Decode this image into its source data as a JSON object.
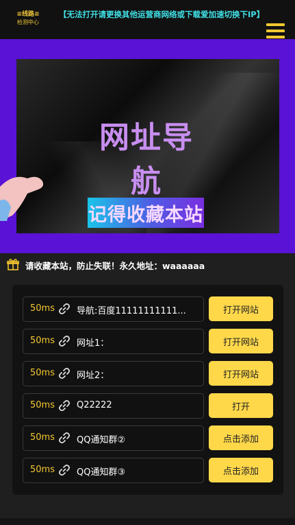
{
  "header": {
    "logo_line1": "≡线路≡",
    "logo_line2": "检测中心",
    "notice": "【无法打开请更换其他运营商网络或下载爱加速切换下IP】",
    "menu_icon": "hamburger-menu-icon"
  },
  "banner": {
    "title": "网址导航",
    "subtitle": "记得收藏本站"
  },
  "bookmark": {
    "icon": "gift-icon",
    "text": "请收藏本站，防止失联！永久地址：waaaaaa"
  },
  "rows": [
    {
      "latency": "50ms",
      "label": "导航:百度11111111111...",
      "button": "打开网站"
    },
    {
      "latency": "50ms",
      "label": "网址1：",
      "button": "打开网站"
    },
    {
      "latency": "50ms",
      "label": "网址2：",
      "button": "打开网站"
    },
    {
      "latency": "50ms",
      "label": "Q22222",
      "button": "打开"
    },
    {
      "latency": "50ms",
      "label": "QQ通知群②",
      "button": "点击添加"
    },
    {
      "latency": "50ms",
      "label": "QQ通知群③",
      "button": "点击添加"
    }
  ],
  "colors": {
    "accent": "#ffd84a",
    "notice": "#40e0e6",
    "banner_bg": "#5a12d6"
  }
}
